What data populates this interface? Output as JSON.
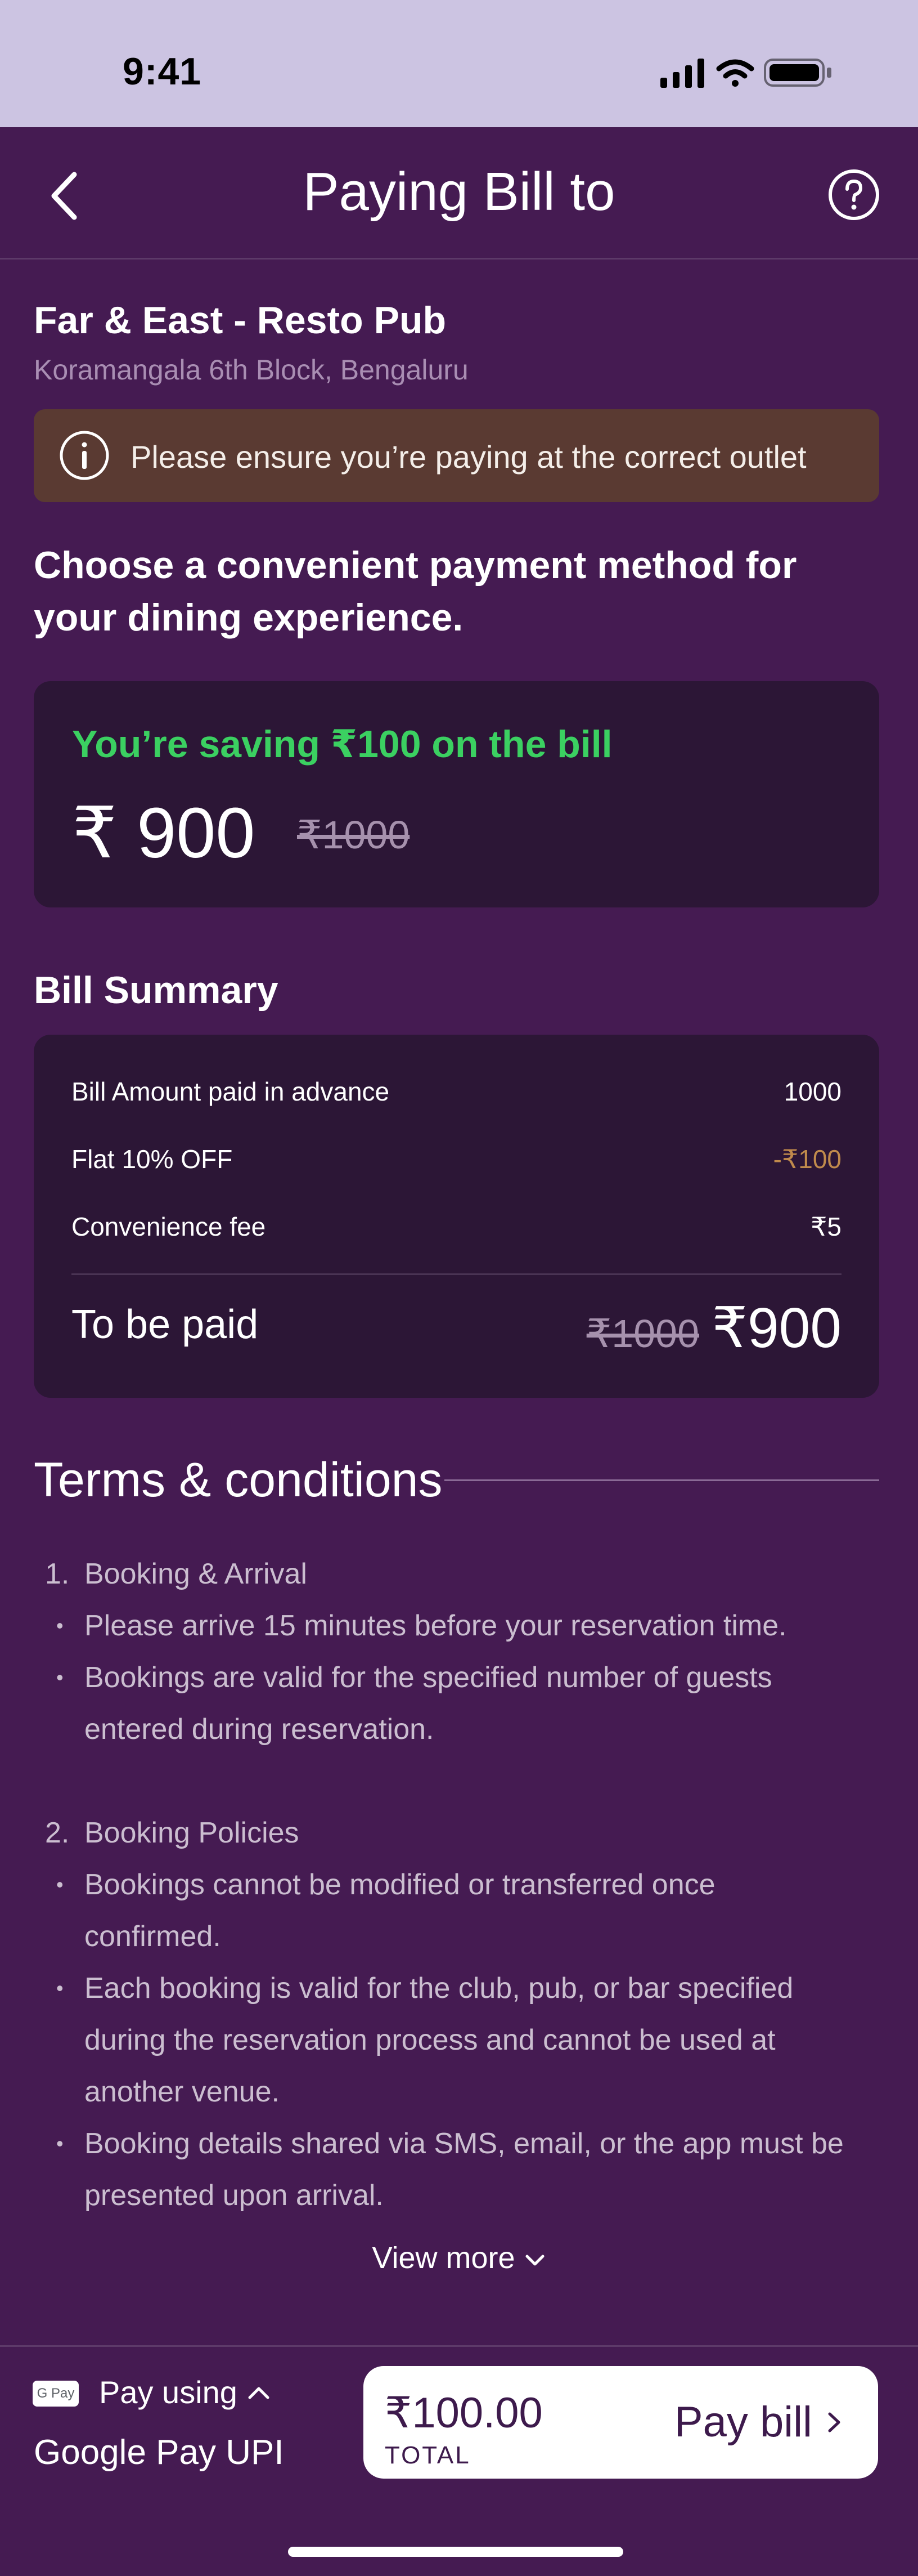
{
  "status_bar": {
    "time": "9:41"
  },
  "header": {
    "title": "Paying Bill to"
  },
  "venue": {
    "name": "Far & East - Resto Pub",
    "address": "Koramangala 6th Block, Bengaluru",
    "notice": "Please  ensure you’re paying at the correct outlet"
  },
  "payment_prompt": "Choose a convenient payment method for your dining experience.",
  "saving": {
    "label": "You’re saving ₹100 on the bill",
    "amount": "₹ 900",
    "original": "₹1000"
  },
  "bill_summary": {
    "title": "Bill Summary",
    "rows": [
      {
        "label": "Bill Amount paid in advance",
        "value": "1000"
      },
      {
        "label": "Flat 10% OFF",
        "value": "-₹100"
      },
      {
        "label": "Convenience fee",
        "value": "₹5"
      }
    ],
    "total_label": "To be paid",
    "total_original": "₹1000",
    "total_final": "₹900"
  },
  "terms": {
    "title": "Terms & conditions",
    "sections": [
      {
        "number": "1.",
        "heading": "Booking & Arrival",
        "items": [
          [
            "Please arrive 15 minutes before your reservation time."
          ],
          [
            "Bookings are valid for the specified number of guests",
            "entered during reservation."
          ]
        ]
      },
      {
        "number": "2.",
        "heading": "Booking Policies",
        "items": [
          [
            "Bookings cannot be modified or transferred once",
            "confirmed."
          ],
          [
            "Each booking is valid for the club, pub, or bar specified",
            "during the reservation process and cannot be used at",
            "another venue."
          ],
          [
            "Booking details shared via SMS, email, or the app must be",
            "presented upon arrival."
          ]
        ]
      }
    ],
    "view_more": "View more"
  },
  "bottom_bar": {
    "badge": "G Pay",
    "pay_using": "Pay using",
    "method": "Google Pay UPI",
    "amount": "₹100.00",
    "total_label": "TOTAL",
    "pay_label": "Pay bill"
  },
  "icons": {
    "back": "chevron-left-icon",
    "help": "question-circle-icon",
    "info": "info-circle-icon",
    "chevron_down": "chevron-down-icon",
    "chevron_up": "chevron-up-icon",
    "chevron_right": "chevron-right-icon"
  },
  "colors": {
    "background": "#451b52",
    "card": "#2c1636",
    "status_bar": "#ccc4e2",
    "saving_green": "#3bd061",
    "discount": "#c08a4c",
    "notice_bg": "#5a3a32"
  }
}
